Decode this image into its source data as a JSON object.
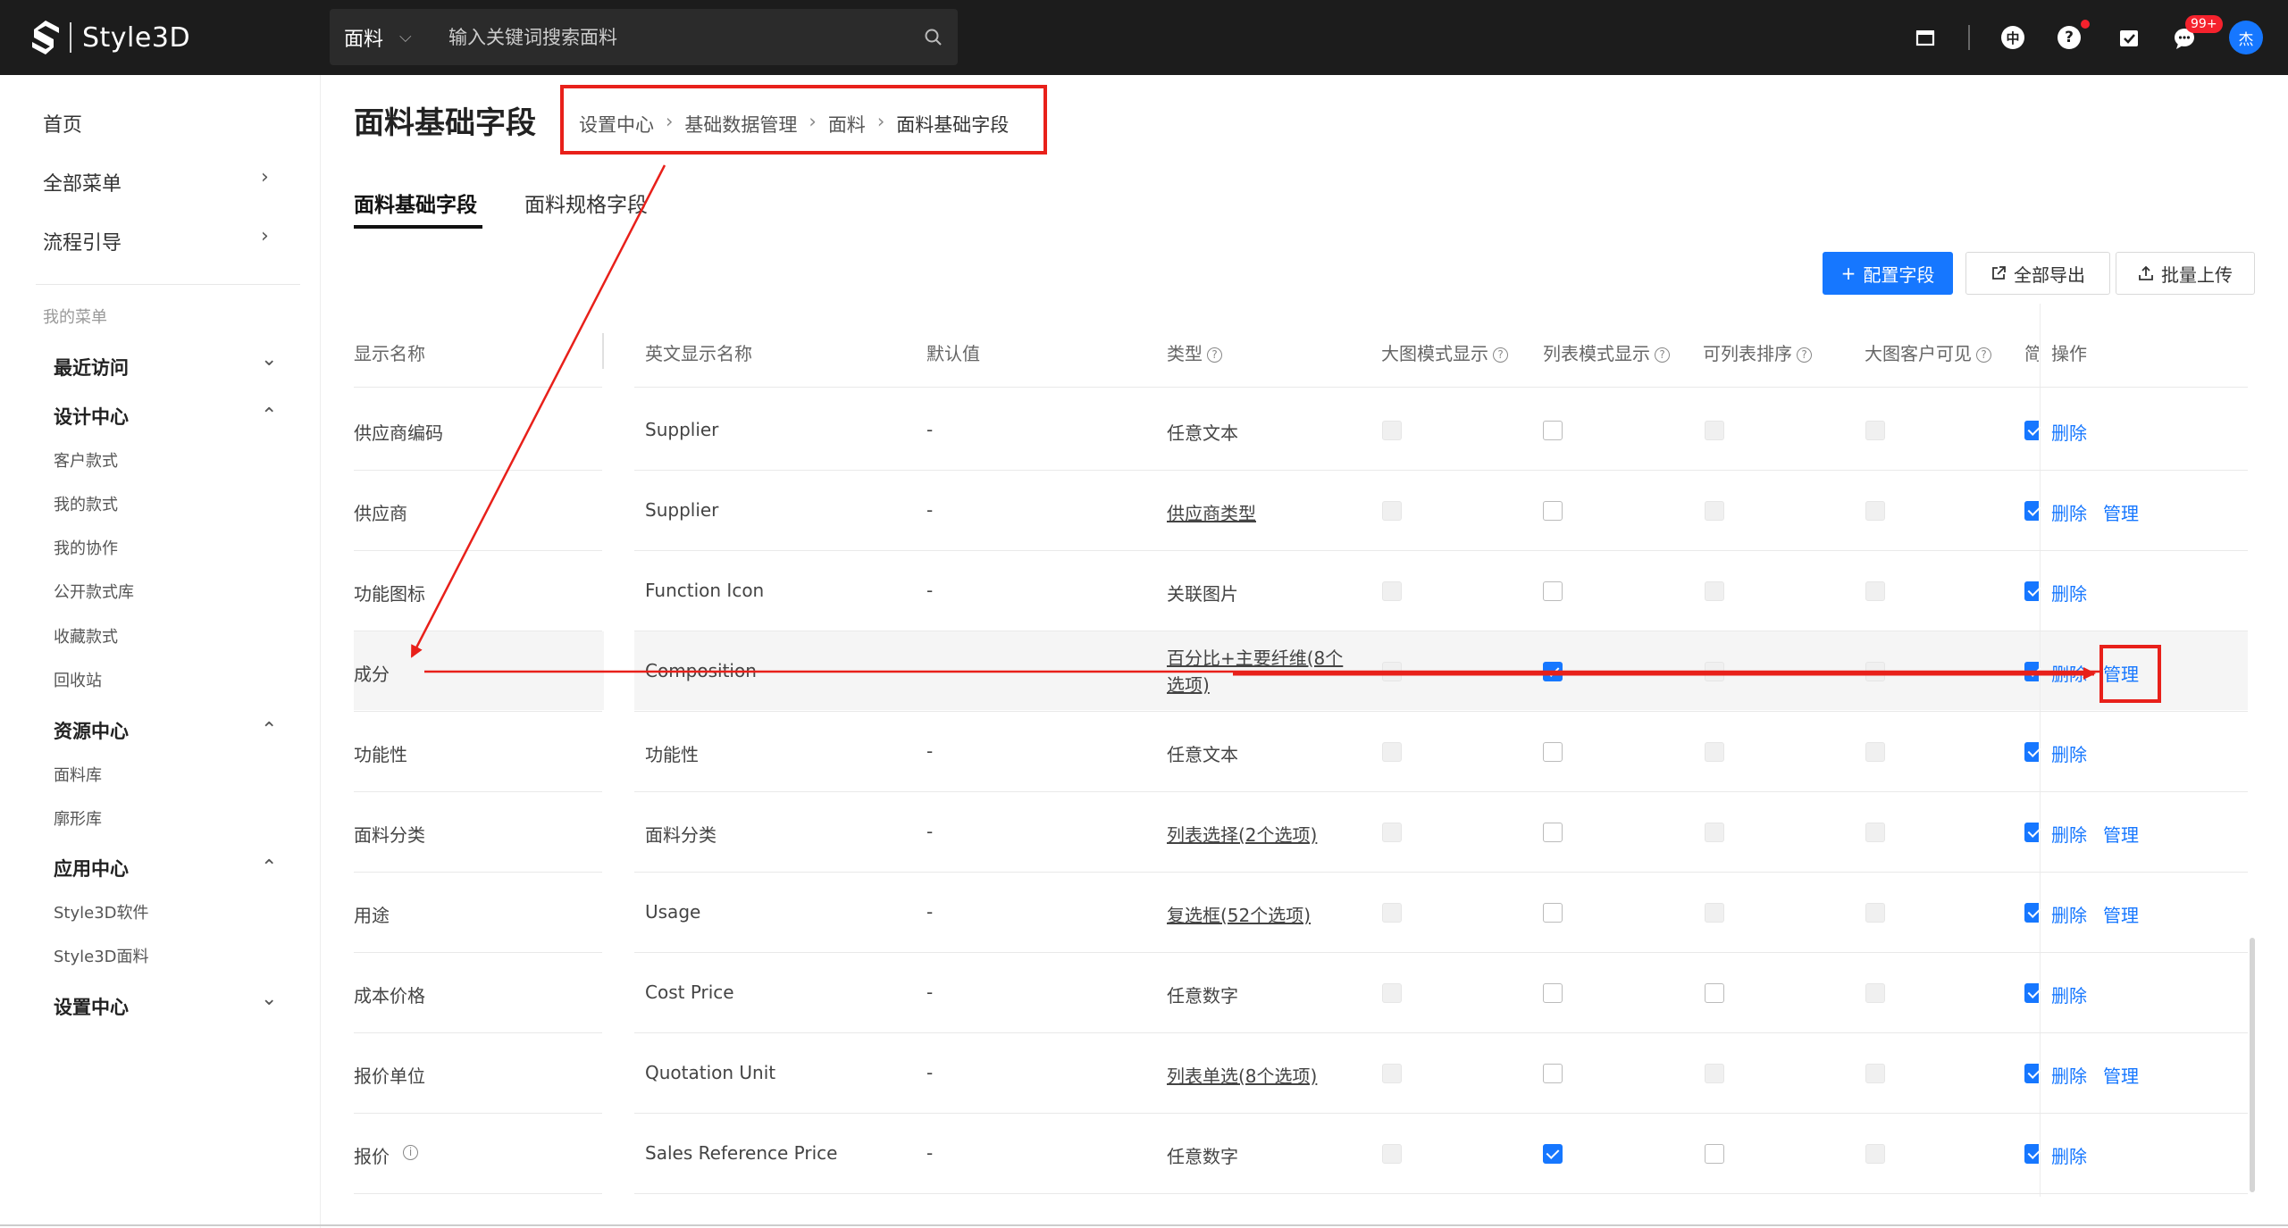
{
  "app": {
    "logo_text": "Style3D"
  },
  "search": {
    "type": "面料",
    "placeholder": "输入关键词搜索面料"
  },
  "header": {
    "lang": "中",
    "help": "?",
    "message_badge": "99+",
    "avatar_text": "杰"
  },
  "sidebar": {
    "top_items": [
      {
        "label": "首页"
      },
      {
        "label": "全部菜单"
      },
      {
        "label": "流程引导"
      }
    ],
    "my_menu_label": "我的菜单",
    "groups": [
      {
        "label": "最近访问"
      },
      {
        "label": "设计中心",
        "subs": [
          "客户款式",
          "我的款式",
          "我的协作",
          "公开款式库",
          "收藏款式",
          "回收站"
        ]
      },
      {
        "label": "资源中心",
        "subs": [
          "面料库",
          "廓形库"
        ]
      },
      {
        "label": "应用中心",
        "subs": [
          "Style3D软件",
          "Style3D面料"
        ]
      },
      {
        "label": "设置中心"
      }
    ]
  },
  "page": {
    "title": "面料基础字段",
    "breadcrumb": [
      "设置中心",
      "基础数据管理",
      "面料",
      "面料基础字段"
    ],
    "tabs": [
      "面料基础字段",
      "面料规格字段"
    ],
    "buttons": {
      "config": "配置字段",
      "export": "全部导出",
      "upload": "批量上传"
    }
  },
  "table": {
    "headers": [
      "显示名称",
      "英文显示名称",
      "默认值",
      "类型",
      "大图模式显示",
      "列表模式显示",
      "可列表排序",
      "大图客户可见",
      "简",
      "操作"
    ],
    "rows": [
      {
        "name": "供应商编码",
        "en": "Supplier",
        "default": "-",
        "type": "任意文本",
        "type_link": false,
        "c1": "dis",
        "c2": "off",
        "c3": "dis",
        "c4": "dis",
        "c5": "on",
        "actions": [
          "删除"
        ]
      },
      {
        "name": "供应商",
        "en": "Supplier",
        "default": "-",
        "type": "供应商类型",
        "type_link": true,
        "c1": "dis",
        "c2": "off",
        "c3": "dis",
        "c4": "dis",
        "c5": "on",
        "actions": [
          "删除",
          "管理"
        ]
      },
      {
        "name": "功能图标",
        "en": "Function Icon",
        "default": "-",
        "type": "关联图片",
        "type_link": false,
        "c1": "dis",
        "c2": "off",
        "c3": "dis",
        "c4": "dis",
        "c5": "on",
        "actions": [
          "删除"
        ]
      },
      {
        "name": "成分",
        "en": "Composition",
        "default": "-",
        "type": "百分比+主要纤维(8个选项)",
        "type_link": true,
        "c1": "dis",
        "c2": "on",
        "c3": "dis",
        "c4": "dis",
        "c5": "on",
        "actions": [
          "删除",
          "管理"
        ]
      },
      {
        "name": "功能性",
        "en": "功能性",
        "default": "-",
        "type": "任意文本",
        "type_link": false,
        "c1": "dis",
        "c2": "off",
        "c3": "dis",
        "c4": "dis",
        "c5": "on",
        "actions": [
          "删除"
        ]
      },
      {
        "name": "面料分类",
        "en": "面料分类",
        "default": "-",
        "type": "列表选择(2个选项)",
        "type_link": true,
        "c1": "dis",
        "c2": "off",
        "c3": "dis",
        "c4": "dis",
        "c5": "on",
        "actions": [
          "删除",
          "管理"
        ]
      },
      {
        "name": "用途",
        "en": "Usage",
        "default": "-",
        "type": "复选框(52个选项)",
        "type_link": true,
        "c1": "dis",
        "c2": "off",
        "c3": "dis",
        "c4": "dis",
        "c5": "on",
        "actions": [
          "删除",
          "管理"
        ]
      },
      {
        "name": "成本价格",
        "en": "Cost Price",
        "default": "-",
        "type": "任意数字",
        "type_link": false,
        "c1": "dis",
        "c2": "off",
        "c3": "off",
        "c4": "dis",
        "c5": "on",
        "actions": [
          "删除"
        ]
      },
      {
        "name": "报价单位",
        "en": "Quotation Unit",
        "default": "-",
        "type": "列表单选(8个选项)",
        "type_link": true,
        "c1": "dis",
        "c2": "off",
        "c3": "dis",
        "c4": "dis",
        "c5": "on",
        "actions": [
          "删除",
          "管理"
        ]
      },
      {
        "name": "报价",
        "en": "Sales Reference Price",
        "default": "-",
        "type": "任意数字",
        "type_link": false,
        "c1": "dis",
        "c2": "on",
        "c3": "off",
        "c4": "dis",
        "c5": "on",
        "actions": [
          "删除"
        ],
        "info": true
      }
    ]
  },
  "colors": {
    "accent": "#1677ff",
    "annotation": "#e8201a",
    "topbar": "#1c1c1c"
  }
}
